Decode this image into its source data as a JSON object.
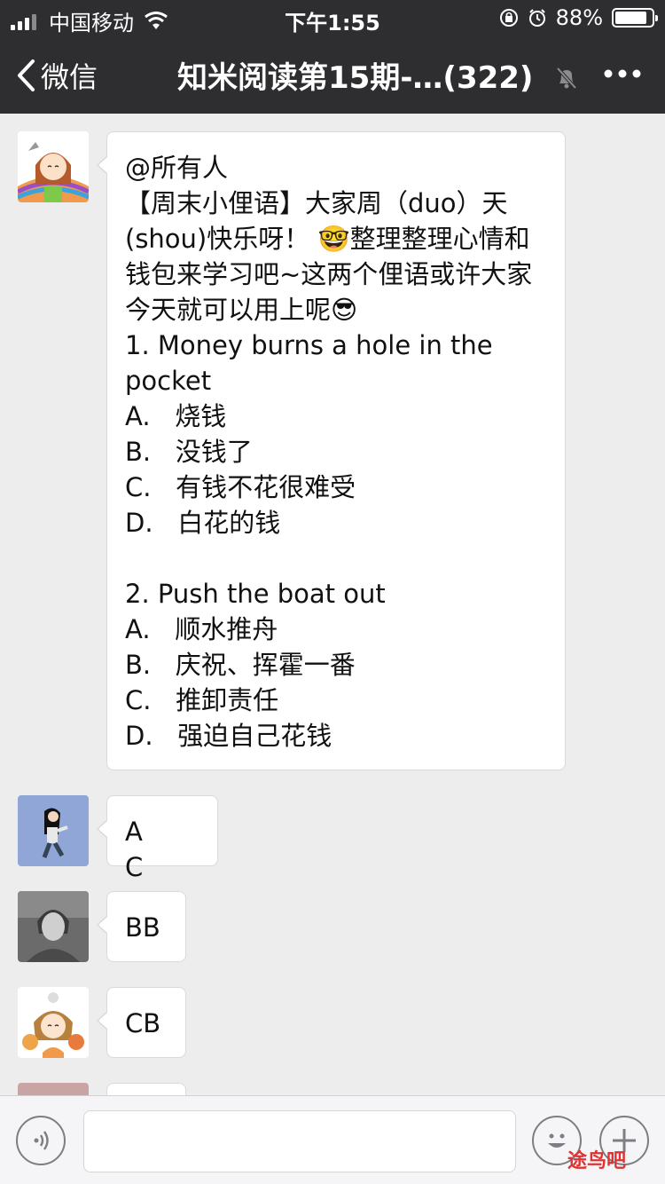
{
  "status_bar": {
    "carrier": "中国移动",
    "time": "下午1:55",
    "battery_text": "88%",
    "battery_level": 0.88
  },
  "nav": {
    "back_label": "微信",
    "title": "知米阅读第15期-…(322)",
    "icons": [
      "back-chevron-icon",
      "mute-bell-icon",
      "more-icon"
    ]
  },
  "messages": [
    {
      "avatar": "cartoon-girl-avatar",
      "text": "@所有人\n【周末小俚语】大家周（duo）天(shou)快乐呀！ 🤓整理整理心情和钱包来学习吧~这两个俚语或许大家今天就可以用上呢😎\n1. Money burns a hole in the pocket\nA.   烧钱\nB.   没钱了\nC.   有钱不花很难受\nD.   白花的钱\n\n2. Push the boat out\nA.   顺水推舟\nB.   庆祝、挥霍一番\nC.   推卸责任\nD.   强迫自己花钱"
    },
    {
      "avatar": "running-girl-avatar",
      "text": "A     C"
    },
    {
      "avatar": "vintage-photo-avatar",
      "text": "BB"
    },
    {
      "avatar": "cartoon-cats-avatar",
      "text": "CB"
    }
  ],
  "input_bar": {
    "voice_icon": "voice-icon",
    "emoji_icon": "emoji-icon",
    "plus_icon": "plus-icon",
    "placeholder": ""
  },
  "watermark": "途鸟吧"
}
